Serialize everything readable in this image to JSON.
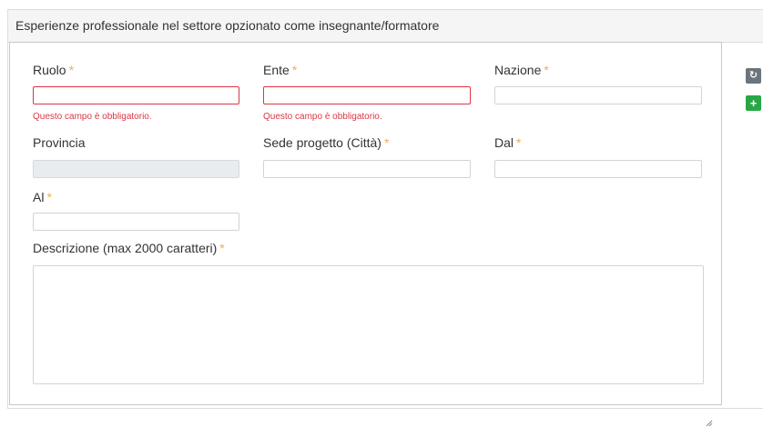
{
  "section": {
    "title": "Esperienze professionale nel settore opzionato come insegnante/formatore"
  },
  "form": {
    "required_mark": "*",
    "ruolo": {
      "label": "Ruolo",
      "value": "",
      "error": "Questo campo è obbligatorio."
    },
    "ente": {
      "label": "Ente",
      "value": "",
      "error": "Questo campo è obbligatorio."
    },
    "nazione": {
      "label": "Nazione",
      "value": ""
    },
    "provincia": {
      "label": "Provincia",
      "value": ""
    },
    "sede": {
      "label": "Sede progetto (Città)",
      "value": ""
    },
    "dal": {
      "label": "Dal",
      "value": ""
    },
    "al": {
      "label": "Al",
      "value": ""
    },
    "descrizione": {
      "label": "Descrizione (max 2000 caratteri)",
      "value": ""
    }
  },
  "actions": {
    "refresh_icon": "↻",
    "add_icon": "+"
  },
  "colors": {
    "error": "#dc3545",
    "required": "#f0ad4e",
    "add_button": "#28a745",
    "refresh_button": "#6c757d"
  }
}
